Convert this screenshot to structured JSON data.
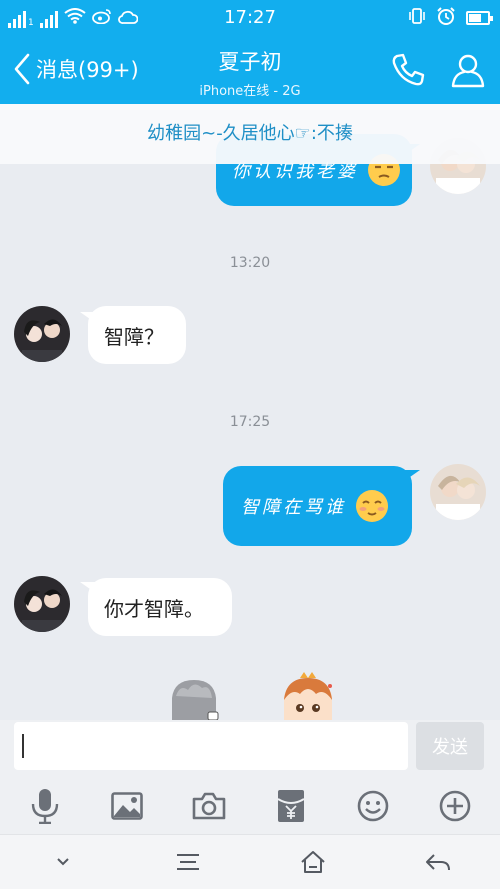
{
  "status_bar": {
    "network_label": "1",
    "time": "17:27"
  },
  "header": {
    "back_label": "消息(99+)",
    "contact_name": "夏子初",
    "contact_status": "iPhone在线 - 2G"
  },
  "banner": {
    "text": "幼稚园~-久居他心☞:不揍"
  },
  "messages": [
    {
      "side": "right",
      "text": "你认识我老婆"
    },
    {
      "timestamp": "13:20"
    },
    {
      "side": "left",
      "text": "智障？"
    },
    {
      "timestamp": "17:25"
    },
    {
      "side": "right",
      "text": "智障在骂谁"
    },
    {
      "side": "left",
      "text": "你才智障。"
    }
  ],
  "input": {
    "value": "",
    "send_label": "发送"
  },
  "toolbar_icons": [
    "microphone-icon",
    "image-icon",
    "camera-icon",
    "red-packet-icon",
    "emoji-icon",
    "plus-icon"
  ],
  "nav_icons": [
    "chevron-down-icon",
    "menu-icon",
    "home-icon",
    "back-arrow-icon"
  ],
  "colors": {
    "accent": "#12aeee",
    "bubble_right": "#12a7ea",
    "bubble_left": "#ffffff",
    "banner_text": "#1f8fc6"
  }
}
